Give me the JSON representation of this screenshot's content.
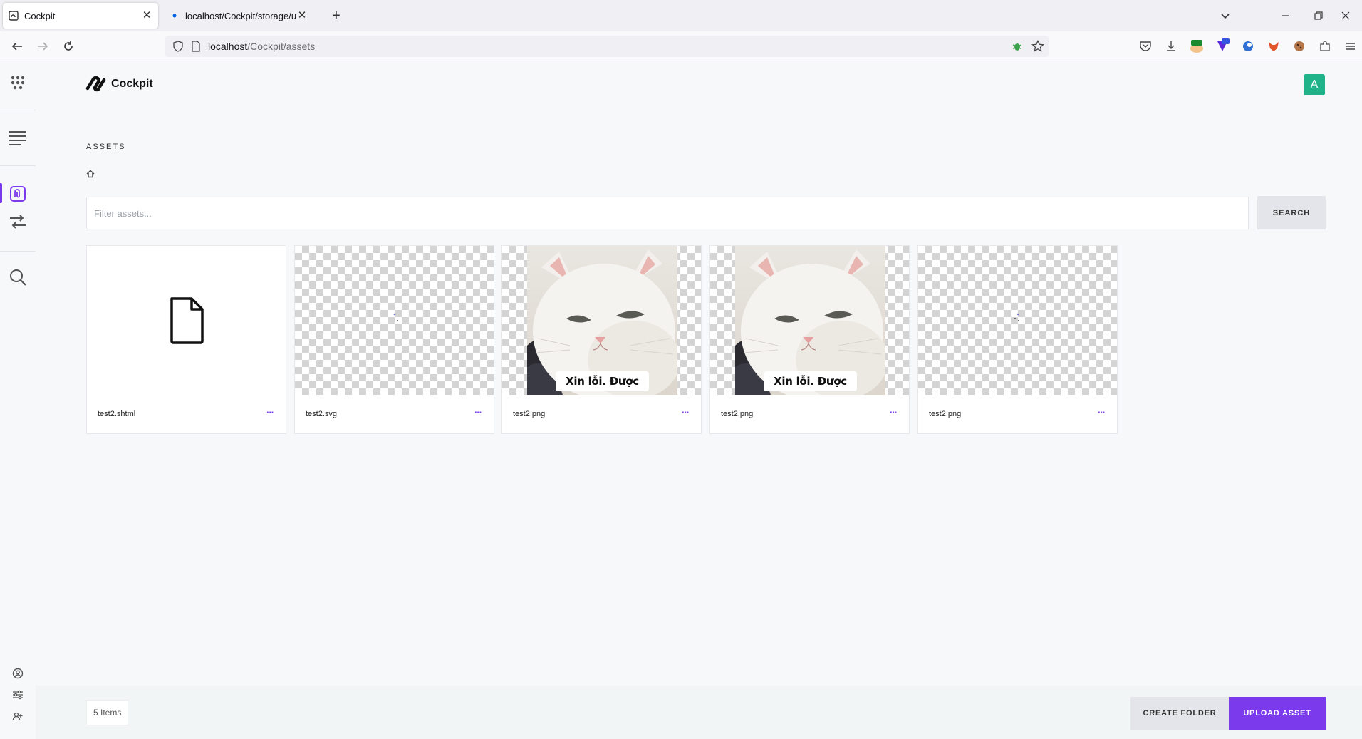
{
  "browser": {
    "tabs": [
      {
        "title": "Cockpit",
        "active": true
      },
      {
        "title": "localhost/Cockpit/storage/uplo",
        "active": false
      }
    ],
    "url": {
      "host": "localhost",
      "path": "/Cockpit/assets"
    }
  },
  "app": {
    "logo_text": "Cockpit",
    "avatar_initial": "A",
    "section_title": "ASSETS",
    "filter_placeholder": "Filter assets...",
    "search_label": "SEARCH",
    "assets": [
      {
        "name": "test2.shtml",
        "thumb": "file-icon"
      },
      {
        "name": "test2.svg",
        "thumb": "transparent"
      },
      {
        "name": "test2.png",
        "thumb": "cat-image",
        "caption": "Xin lỗi. Được chưa"
      },
      {
        "name": "test2.png",
        "thumb": "cat-image",
        "caption": "Xin lỗi. Được chưa"
      },
      {
        "name": "test2.png",
        "thumb": "transparent"
      }
    ],
    "more_label": "···",
    "item_count": "5 Items",
    "create_folder_label": "CREATE FOLDER",
    "upload_label": "UPLOAD ASSET"
  },
  "colors": {
    "accent": "#7c3aed",
    "avatar": "#20b38a"
  }
}
